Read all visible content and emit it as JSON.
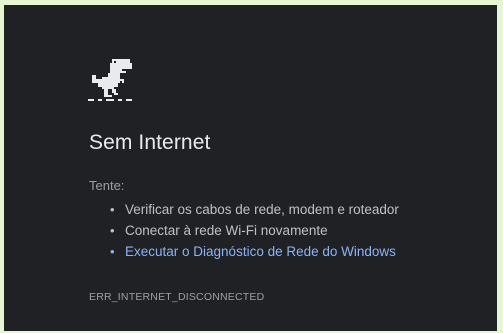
{
  "page": {
    "background": "#202124",
    "accent_link": "#8ab4f8"
  },
  "error": {
    "icon": "offline-dino-icon",
    "title": "Sem Internet",
    "try_label": "Tente:",
    "suggestions": [
      {
        "label": "Verificar os cabos de rede, modem e roteador",
        "is_link": false
      },
      {
        "label": "Conectar à rede Wi-Fi novamente",
        "is_link": false
      },
      {
        "label": "Executar o Diagnóstico de Rede do Windows",
        "is_link": true
      }
    ],
    "code": "ERR_INTERNET_DISCONNECTED"
  }
}
